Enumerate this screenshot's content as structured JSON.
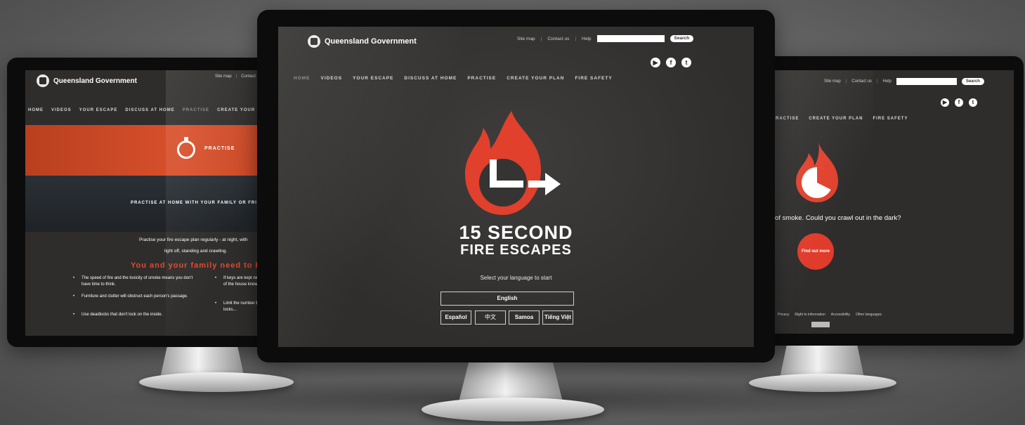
{
  "common": {
    "logo_text": "Queensland Government",
    "site_map": "Site map",
    "contact_us": "Contact us",
    "help": "Help",
    "search_button": "Search",
    "nav": [
      "HOME",
      "VIDEOS",
      "YOUR ESCAPE",
      "DISCUSS AT HOME",
      "PRACTISE",
      "CREATE YOUR PLAN",
      "FIRE SAFETY"
    ],
    "social_icons": [
      "youtube-icon",
      "facebook-icon",
      "twitter-icon"
    ]
  },
  "center": {
    "title": "15 SECOND",
    "subtitle": "FIRE ESCAPES",
    "select_language": "Select your language to start",
    "languages": {
      "english": "English",
      "espanol": "Español",
      "chinese": "中文",
      "samoa": "Samoa",
      "vietnamese": "Tiếng Việt"
    },
    "colors": {
      "flame": "#e0402c",
      "background": "#353433"
    }
  },
  "left": {
    "banner_label": "PRACTISE",
    "strip_text": "PRACTISE AT HOME WITH YOUR FAMILY OR FRIENDS",
    "para_1": "Practise your fire escape plan regularly - at night, with",
    "para_2": "light off, standing and crawling.",
    "heading": "You and your family need to know",
    "bullets_col1": [
      "The speed of fire and the toxicity of smoke means you don't have time to think.",
      "Furniture and clutter will obstruct each person's passage.",
      "Use deadlocks that don't lock on the inside."
    ],
    "bullets_col2": [
      "If keys are kept near the door of the house know...",
      "Limit the number by having locks..."
    ],
    "colors": {
      "banner": "#d24a28",
      "heading": "#e04a2a"
    }
  },
  "right": {
    "question": "of smoke. Could you crawl out in the dark?",
    "button_label": "Find out more",
    "footer_links": [
      "Privacy",
      "Right to information",
      "Accessibility",
      "Other languages"
    ]
  }
}
